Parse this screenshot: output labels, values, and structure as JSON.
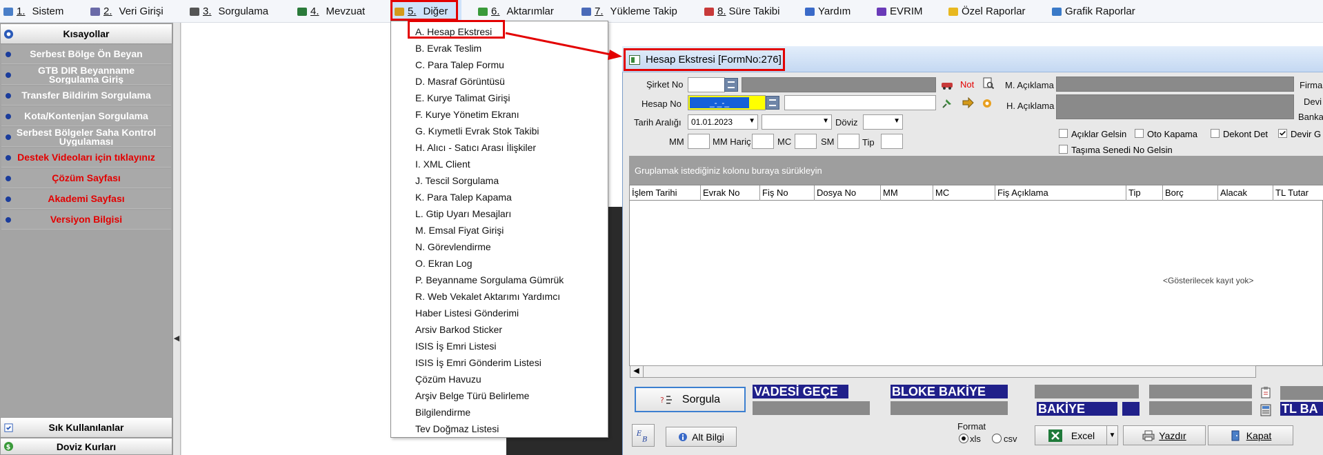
{
  "menu": [
    {
      "num": "1.",
      "label": "Sistem",
      "icon": "system-icon",
      "color": "#4a7fc8"
    },
    {
      "num": "2.",
      "label": "Veri Girişi",
      "icon": "edit-icon",
      "color": "#6a6aa8"
    },
    {
      "num": "3.",
      "label": "Sorgulama",
      "icon": "query-icon",
      "color": "#555555"
    },
    {
      "num": "4.",
      "label": "Mevzuat",
      "icon": "books-icon",
      "color": "#2a7a3a"
    },
    {
      "num": "5.",
      "label": "Diğer",
      "icon": "other-icon",
      "color": "#d49a1a"
    },
    {
      "num": "6.",
      "label": "Aktarımlar",
      "icon": "transfer-icon",
      "color": "#3a9a3a"
    },
    {
      "num": "7.",
      "label": "Yükleme Takip",
      "icon": "upload-icon",
      "color": "#4a6ab8"
    },
    {
      "num": "8.",
      "label": "Süre Takibi",
      "icon": "calendar-icon",
      "color": "#c83a3a"
    },
    {
      "num": "",
      "label": "Yardım",
      "icon": "help-icon",
      "color": "#3a6ac8"
    },
    {
      "num": "",
      "label": "EVRIM",
      "icon": "evrim-icon",
      "color": "#6a3ab8"
    },
    {
      "num": "",
      "label": "Özel Raporlar",
      "icon": "star-icon",
      "color": "#e8b820"
    },
    {
      "num": "",
      "label": "Grafik Raporlar",
      "icon": "chart-icon",
      "color": "#3a7ac8"
    }
  ],
  "sidebar": {
    "header": "Kısayollar",
    "items": [
      {
        "label": "Serbest Bölge Ön Beyan",
        "red": false
      },
      {
        "label": "GTB DIR Beyanname Sorgulama Giriş",
        "red": false
      },
      {
        "label": "Transfer Bildirim Sorgulama",
        "red": false
      },
      {
        "label": "Kota/Kontenjan Sorgulama",
        "red": false
      },
      {
        "label": "Serbest Bölgeler Saha Kontrol Uygulaması",
        "red": false
      },
      {
        "label": "Destek Videoları için tıklayınız",
        "red": true
      },
      {
        "label": "Çözüm Sayfası",
        "red": true
      },
      {
        "label": "Akademi Sayfası",
        "red": true
      },
      {
        "label": "Versiyon Bilgisi",
        "red": true
      }
    ],
    "footer1": "Sık Kullanılanlar",
    "footer2": "Doviz Kurları"
  },
  "dropdown": [
    "A. Hesap Ekstresi",
    "B. Evrak Teslim",
    "C. Para Talep Formu",
    "D. Masraf Görüntüsü",
    "E. Kurye Talimat Girişi",
    "F. Kurye Yönetim Ekranı",
    "G. Kıymetli Evrak Stok Takibi",
    "H. Alıcı - Satıcı Arası İlişkiler",
    "I. XML Client",
    "J. Tescil Sorgulama",
    "K. Para Talep Kapama",
    "L. Gtip Uyarı Mesajları",
    "M. Emsal Fiyat Girişi",
    "N. Görevlendirme",
    "O. Ekran Log",
    "P. Beyanname Sorgulama Gümrük",
    "R. Web Vekalet Aktarımı Yardımcı",
    "Haber Listesi Gönderimi",
    "Arsiv Barkod Sticker",
    "ISIS İş Emri Listesi",
    "ISIS İş Emri Gönderim Listesi",
    "Çözüm Havuzu",
    "Arşiv Belge Türü Belirleme",
    "Bilgilendirme",
    "Tev Doğmaz Listesi"
  ],
  "form": {
    "title": "Hesap Ekstresi [FormNo:276]",
    "sirket_no": "Şirket No",
    "hesap_no": "Hesap No",
    "hesap_no_value": "_-_-_",
    "not": "Not",
    "m_aciklama": "M. Açıklama",
    "h_aciklama": "H. Açıklama",
    "firma": "Firma",
    "devir": "Devi",
    "banka": "Banka",
    "tarih_araligi": "Tarih Aralığı",
    "tarih_value": "01.01.2023",
    "doviz": "Döviz",
    "mm": "MM",
    "mm_haric": "MM Hariç",
    "mc": "MC",
    "sm": "SM",
    "tip": "Tip",
    "checks": [
      {
        "label": "Açıklar Gelsin",
        "checked": false
      },
      {
        "label": "Oto Kapama",
        "checked": false
      },
      {
        "label": "Dekont Det",
        "checked": false
      },
      {
        "label": "Devir G",
        "checked": true
      },
      {
        "label": "Taşıma Senedi No Gelsin",
        "checked": false
      }
    ],
    "group_hint": "Gruplamak istediğiniz kolonu buraya sürükleyin",
    "columns": [
      "İşlem Tarihi",
      "Evrak No",
      "Fiş No",
      "Dosya No",
      "MM",
      "MC",
      "Fiş Açıklama",
      "Tip",
      "Borç",
      "Alacak",
      "TL Tutar"
    ],
    "empty": "<Gösterilecek kayıt yok>",
    "sorgula": "Sorgula",
    "vadesi": "VADESİ GEÇE",
    "bloke": "BLOKE BAKİYE",
    "bakiye": "BAKİYE",
    "tl_bakiye": "TL BA",
    "alt_bilgi": "Alt Bilgi",
    "format": "Format",
    "xls": "xls",
    "csv": "csv",
    "excel": "Excel",
    "yazdir": "Yazdır",
    "kapat": "Kapat"
  }
}
